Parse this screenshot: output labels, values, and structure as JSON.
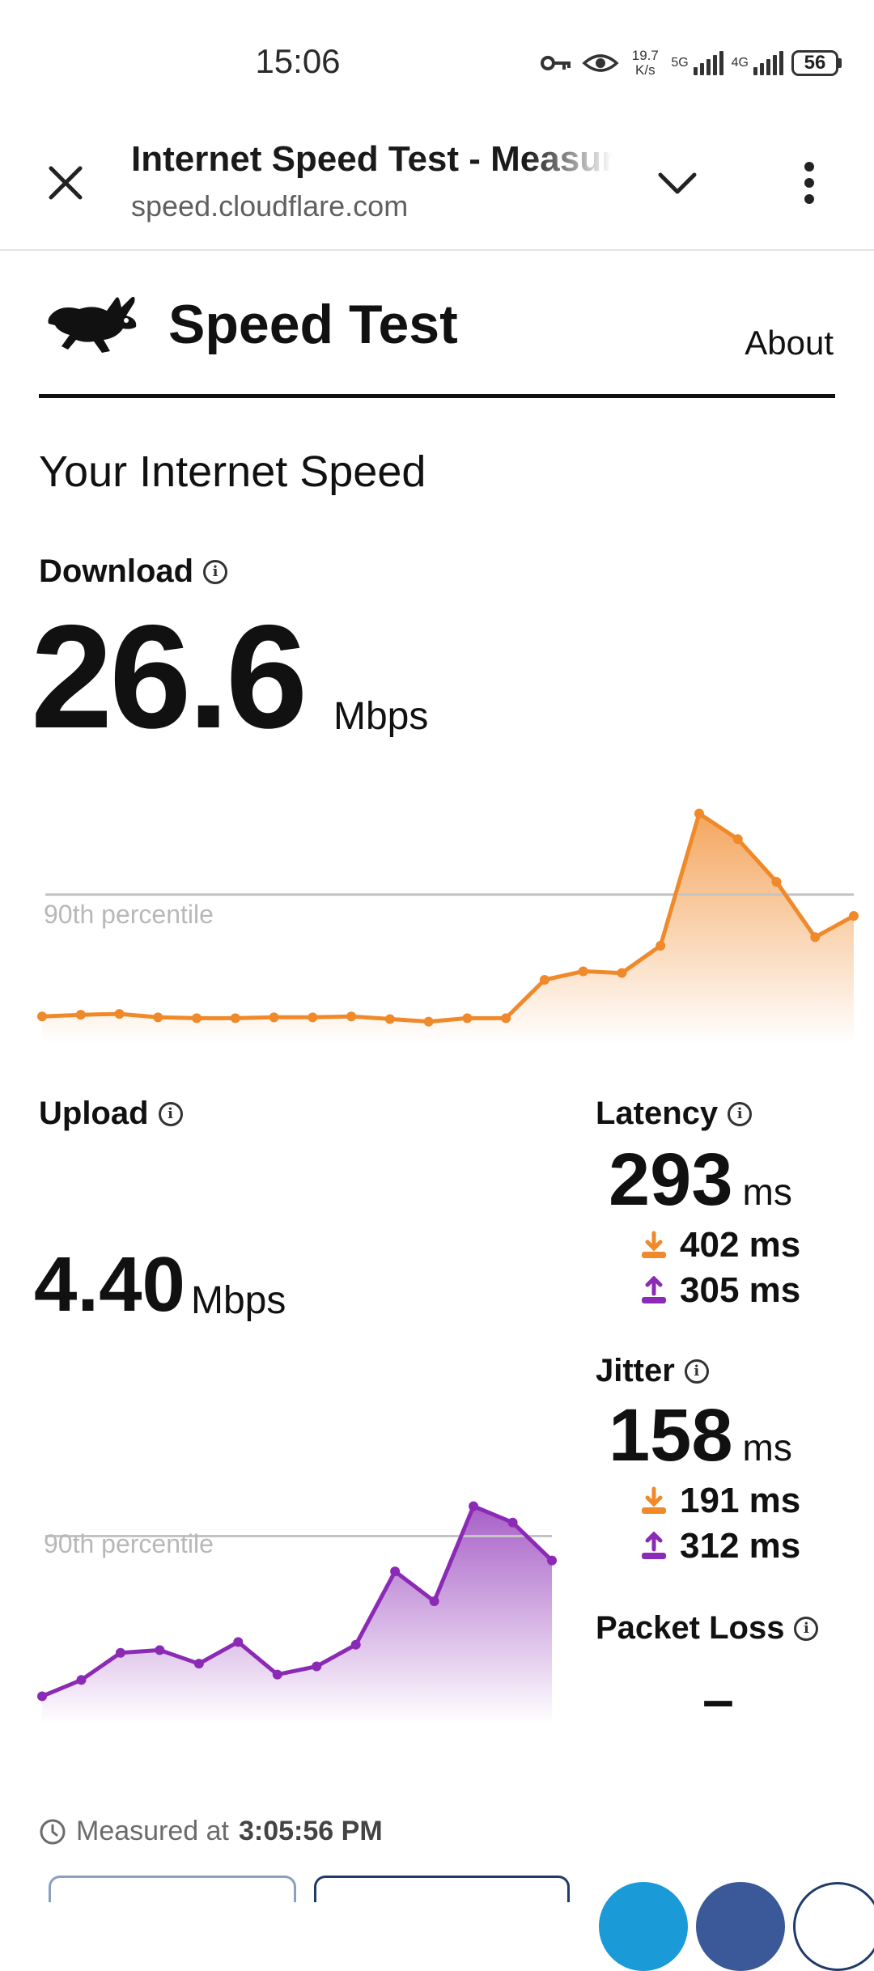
{
  "status_bar": {
    "time": "15:06",
    "net_speed_value": "19.7",
    "net_speed_unit": "K/s",
    "network_1": "5G",
    "network_2": "4G",
    "battery": "56",
    "icons": [
      "vpn-key-icon",
      "eye-icon",
      "signal-icon",
      "battery-icon"
    ]
  },
  "browser": {
    "tab_title": "Internet Speed Test - Measure Network Performance",
    "url": "speed.cloudflare.com"
  },
  "site": {
    "title": "Speed Test",
    "about_label": "About"
  },
  "main": {
    "heading": "Your Internet Speed",
    "download": {
      "label": "Download",
      "value": "26.6",
      "unit": "Mbps"
    },
    "upload": {
      "label": "Upload",
      "value": "4.40",
      "unit": "Mbps"
    },
    "percentile_label": "90th percentile",
    "latency": {
      "label": "Latency",
      "value": "293",
      "unit": "ms",
      "down": "402 ms",
      "up": "305 ms"
    },
    "jitter": {
      "label": "Jitter",
      "value": "158",
      "unit": "ms",
      "down": "191 ms",
      "up": "312 ms"
    },
    "packet_loss": {
      "label": "Packet Loss",
      "value": "–"
    },
    "measured_prefix": "Measured at",
    "measured_time": "3:05:56 PM"
  },
  "colors": {
    "download": "#f0892a",
    "upload": "#8b2bb5"
  },
  "chart_data": [
    {
      "type": "area",
      "series": [
        {
          "name": "Download",
          "values": [
            3.2,
            3.4,
            3.5,
            3.1,
            3.0,
            3.0,
            3.1,
            3.1,
            3.2,
            2.9,
            2.6,
            3.0,
            3.0,
            7.5,
            8.5,
            8.3,
            11.5,
            27.0,
            24.0,
            19.0,
            12.5,
            15.0
          ]
        }
      ],
      "percentile_90": 17.5,
      "ylim": [
        0,
        28
      ]
    },
    {
      "type": "area",
      "series": [
        {
          "name": "Upload",
          "values": [
            0.5,
            0.8,
            1.3,
            1.35,
            1.1,
            1.5,
            0.9,
            1.05,
            1.45,
            2.8,
            2.25,
            4.0,
            3.7,
            3.0
          ]
        }
      ],
      "percentile_90": 3.45,
      "ylim": [
        0,
        4.5
      ]
    }
  ]
}
